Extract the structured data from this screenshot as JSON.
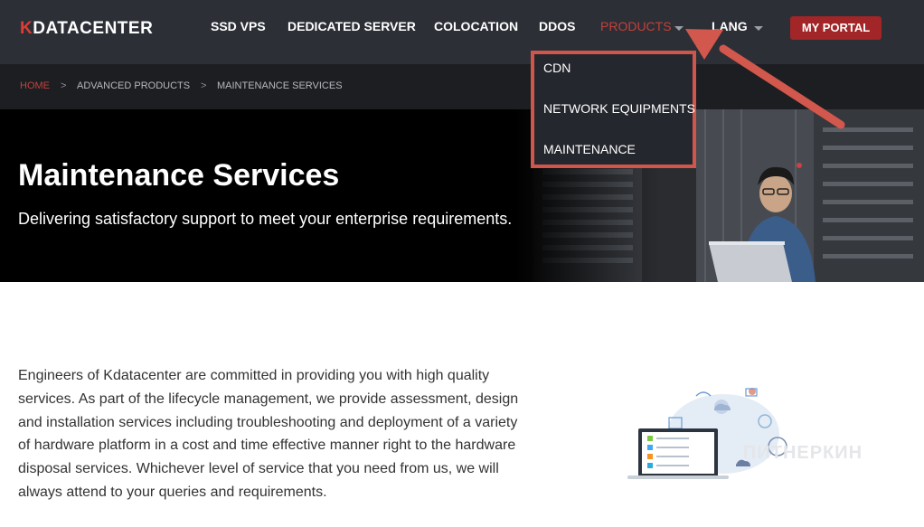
{
  "brand": {
    "logo_k": "K",
    "logo_text": "DATACENTER"
  },
  "nav": {
    "items": [
      {
        "label": "SSD VPS"
      },
      {
        "label": "DEDICATED SERVER"
      },
      {
        "label": "COLOCATION"
      },
      {
        "label": "DDOS"
      },
      {
        "label": "PRODUCTS"
      },
      {
        "label": "LANG"
      }
    ],
    "portal": "MY PORTAL"
  },
  "dropdown": {
    "items": [
      "CDN",
      "NETWORK EQUIPMENTS",
      "MAINTENANCE"
    ]
  },
  "breadcrumb": [
    "HOME",
    "ADVANCED PRODUCTS",
    "MAINTENANCE SERVICES"
  ],
  "breadcrumb_sep": ">",
  "hero": {
    "title": "Maintenance Services",
    "subtitle": "Delivering satisfactory support to meet your enterprise requirements."
  },
  "content": {
    "paragraph": "Engineers of Kdatacenter are committed in providing you with high quality services. As part of the lifecycle management, we provide assessment, design and installation services including troubleshooting and deployment of a variety of hardware platform in a cost and time effective manner right to the hardware disposal services. Whichever level of service that you need from us, we will always attend to your queries and requirements."
  },
  "watermark": "ПИТНЕРКИН",
  "colors": {
    "header_bg": "#2c2f36",
    "accent_red": "#a22527",
    "annotation": "#cf564b",
    "active_nav": "#c2403a"
  },
  "icons": [
    "caret-down-icon",
    "arrow-annotation",
    "cloud-network-illustration"
  ]
}
